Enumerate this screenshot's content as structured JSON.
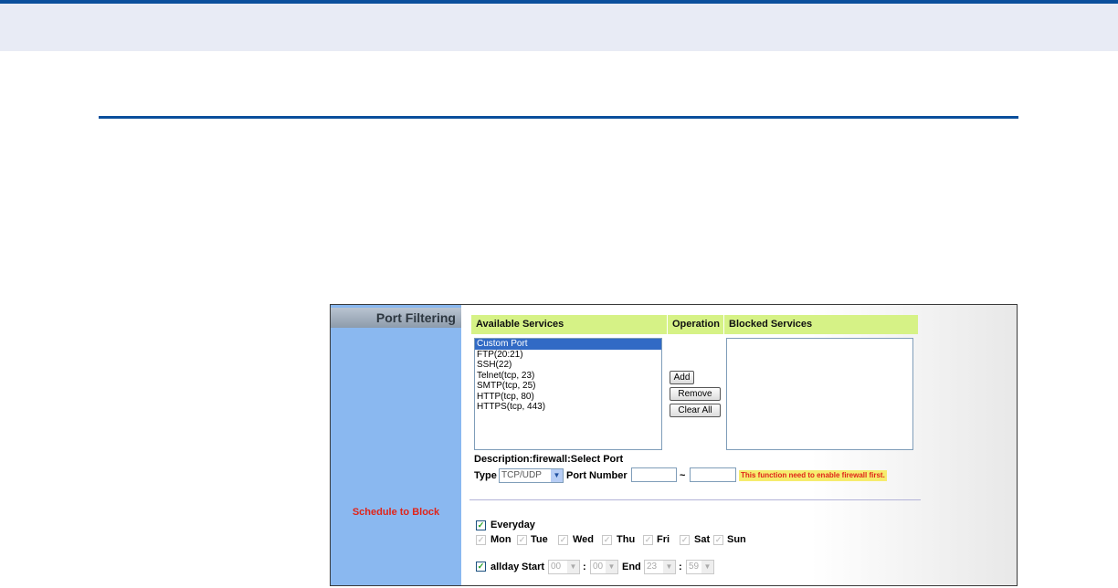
{
  "panel": {
    "section_title": "Port Filtering",
    "schedule_label": "Schedule to Block",
    "columns": {
      "available": "Available Services",
      "operation": "Operation",
      "blocked": "Blocked Services"
    },
    "available_services": [
      "Custom Port",
      "FTP(20:21)",
      "SSH(22)",
      "Telnet(tcp, 23)",
      "SMTP(tcp, 25)",
      "HTTP(tcp, 80)",
      "HTTPS(tcp, 443)"
    ],
    "selected_service": "Custom Port",
    "blocked_services": [],
    "buttons": {
      "add": "Add",
      "remove": "Remove",
      "clear_all": "Clear All"
    },
    "description": "Description:firewall:Select Port",
    "type_label": "Type",
    "type_value": "TCP/UDP",
    "port_number_label": "Port Number",
    "port_from": "",
    "port_to": "",
    "tilde": "~",
    "warning": "This function need to enable firewall first."
  },
  "schedule": {
    "everyday_label": "Everyday",
    "everyday_checked": true,
    "days": [
      "Mon",
      "Tue",
      "Wed",
      "Thu",
      "Fri",
      "Sat",
      "Sun"
    ],
    "allday_label": "allday",
    "allday_checked": true,
    "start_label": "Start",
    "start_hour": "00",
    "start_minute": "00",
    "end_label": "End",
    "end_hour": "23",
    "end_minute": "59",
    "colon": ":"
  },
  "colors": {
    "header_blue": "#0b4f9c",
    "sidebar_blue": "#8ab8f0",
    "column_header_green": "#d6f286",
    "warning_red": "#e0241a",
    "warning_bg": "#f6ec6e"
  }
}
